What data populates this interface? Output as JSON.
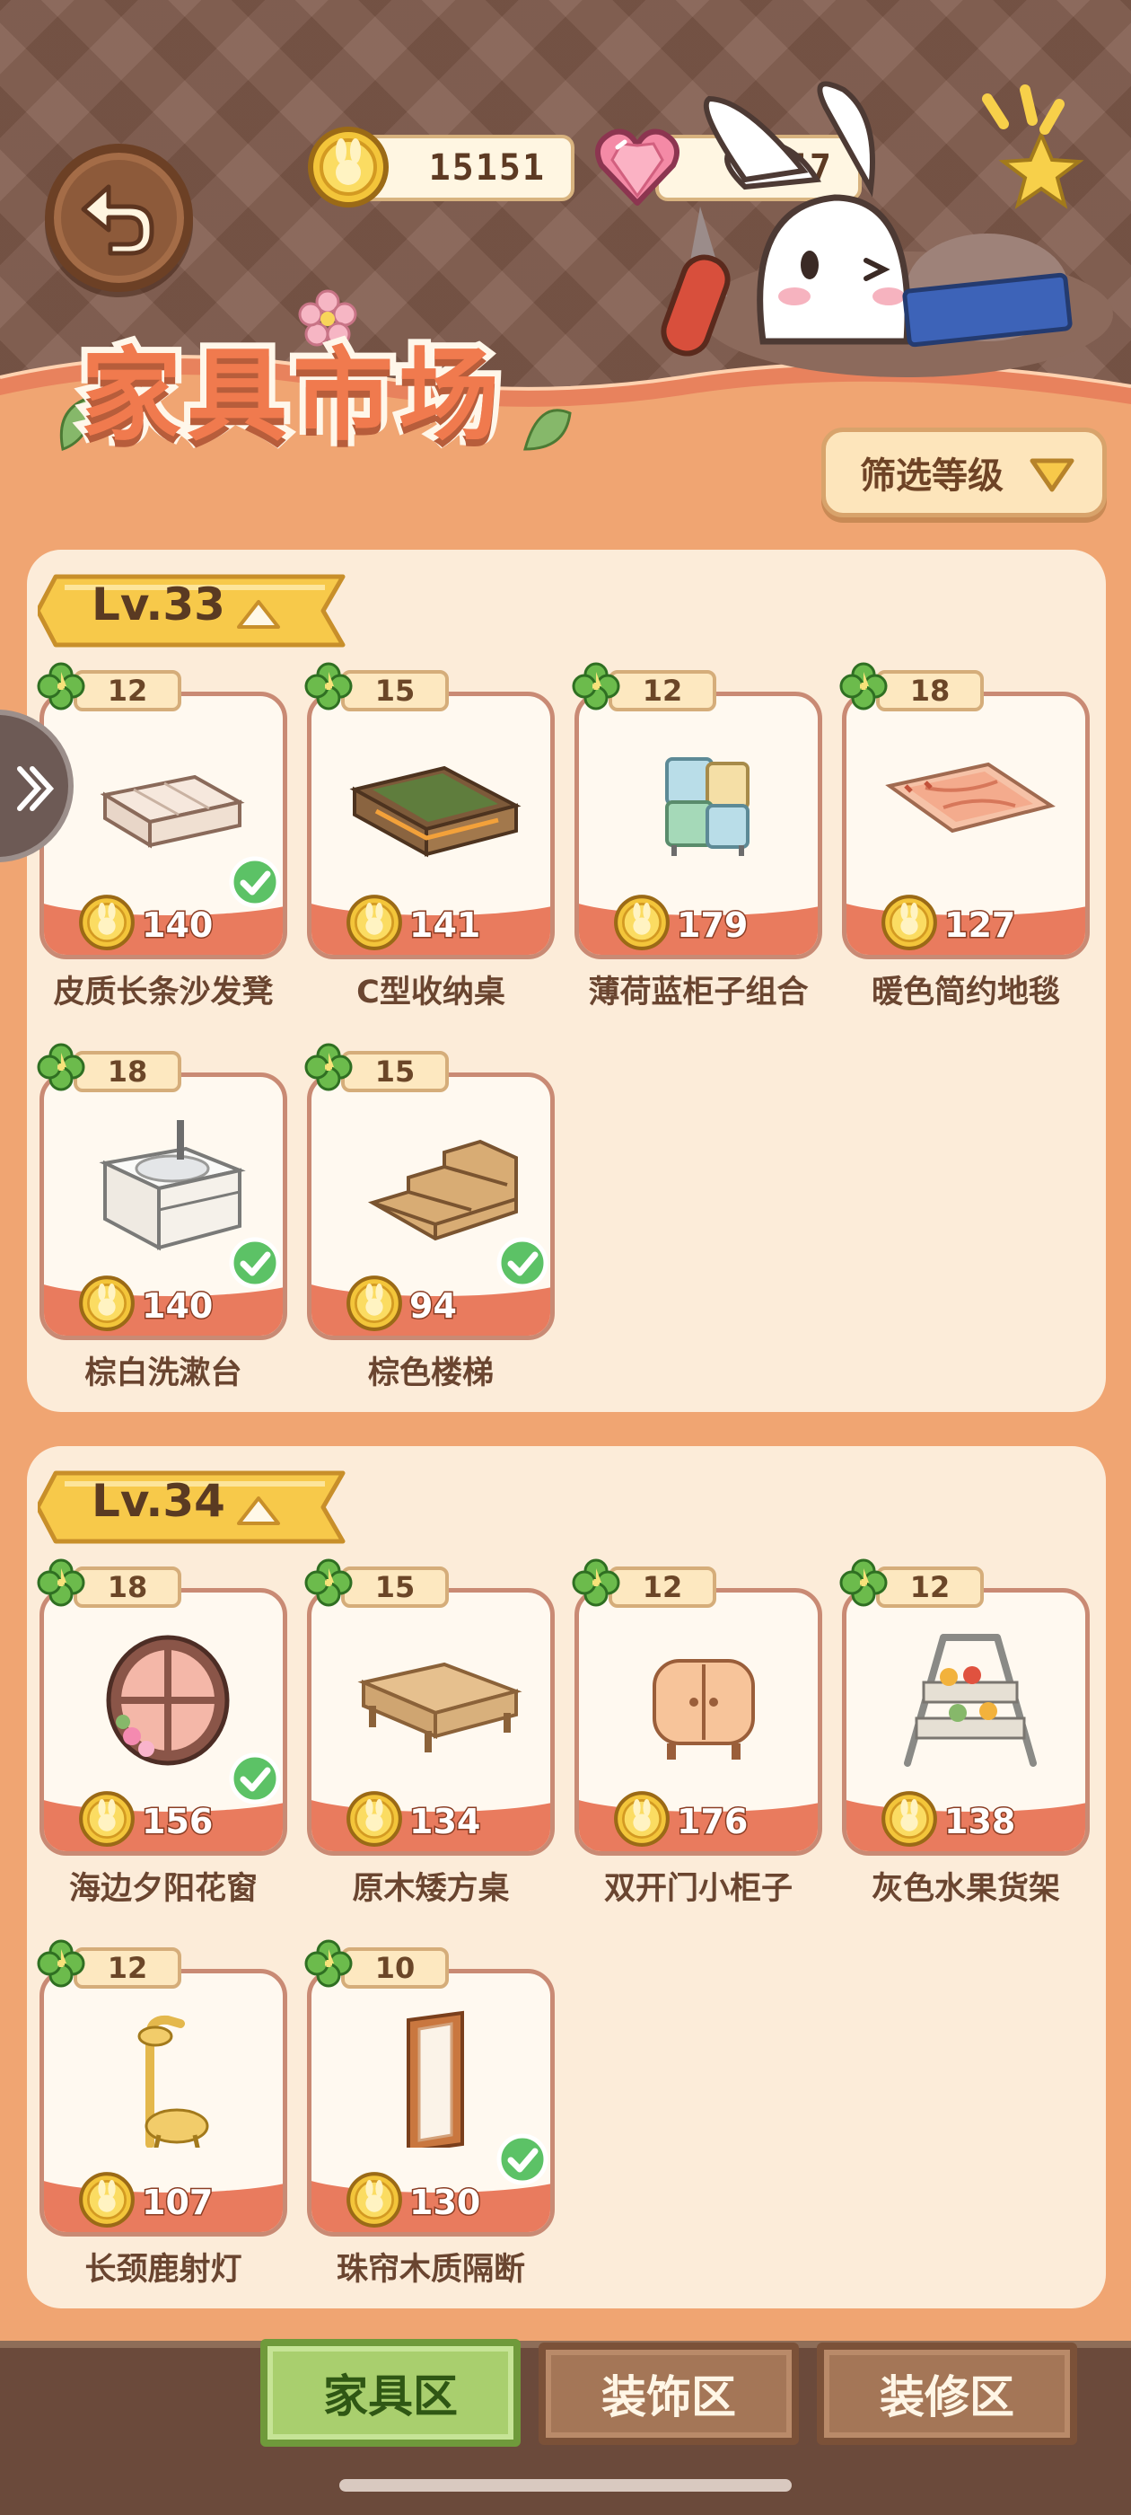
{
  "header": {
    "title": "家具市场",
    "coins": "15151",
    "hearts": "4547"
  },
  "filter": {
    "label": "筛选等级"
  },
  "sections": [
    {
      "level": "Lv.33",
      "items": [
        {
          "tag": "12",
          "price": "140",
          "name": "皮质长条沙发凳",
          "owned": true
        },
        {
          "tag": "15",
          "price": "141",
          "name": "C型收纳桌",
          "owned": false
        },
        {
          "tag": "12",
          "price": "179",
          "name": "薄荷蓝柜子组合",
          "owned": false
        },
        {
          "tag": "18",
          "price": "127",
          "name": "暖色简约地毯",
          "owned": false
        },
        {
          "tag": "18",
          "price": "140",
          "name": "棕白洗漱台",
          "owned": true
        },
        {
          "tag": "15",
          "price": "94",
          "name": "棕色楼梯",
          "owned": true
        }
      ]
    },
    {
      "level": "Lv.34",
      "items": [
        {
          "tag": "18",
          "price": "156",
          "name": "海边夕阳花窗",
          "owned": true
        },
        {
          "tag": "15",
          "price": "134",
          "name": "原木矮方桌",
          "owned": false
        },
        {
          "tag": "12",
          "price": "176",
          "name": "双开门小柜子",
          "owned": false
        },
        {
          "tag": "12",
          "price": "138",
          "name": "灰色水果货架",
          "owned": false
        },
        {
          "tag": "12",
          "price": "107",
          "name": "长颈鹿射灯",
          "owned": false
        },
        {
          "tag": "10",
          "price": "130",
          "name": "珠帘木质隔断",
          "owned": true
        }
      ]
    }
  ],
  "tabs": [
    {
      "label": "家具区",
      "active": true
    },
    {
      "label": "装饰区",
      "active": false
    },
    {
      "label": "装修区",
      "active": false
    }
  ],
  "colors": {
    "header_bg": "#7f5a4b",
    "panel_bg": "#fcecd9",
    "price_band": "#e97b5e",
    "accent_green": "#a9cf6e"
  }
}
